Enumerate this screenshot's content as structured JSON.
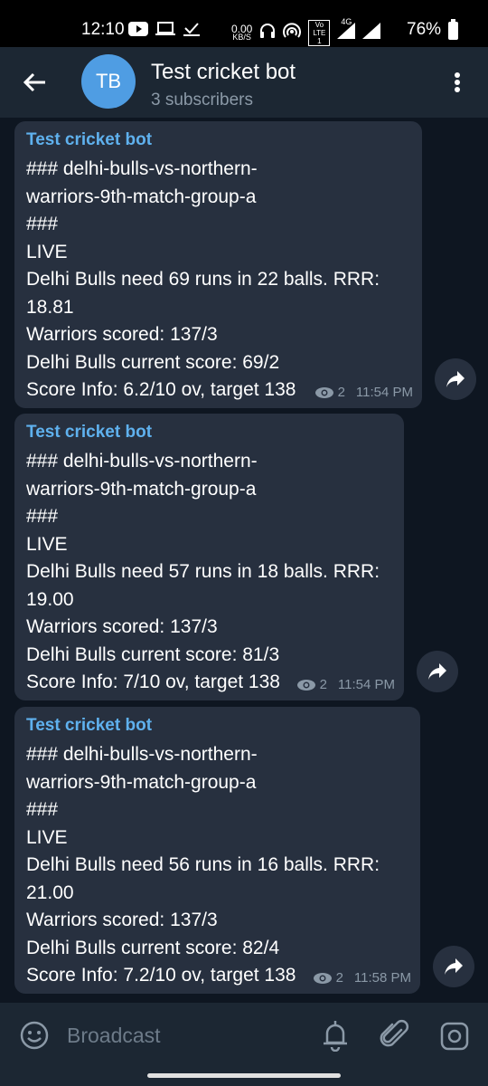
{
  "status_bar": {
    "time": "12:10",
    "netspeed_value": "0.00",
    "netspeed_unit": "KB/S",
    "volte_label": "Vo LTE 1",
    "network_label": "4G",
    "battery_percent": "76%"
  },
  "header": {
    "avatar_initials": "TB",
    "title": "Test cricket bot",
    "subtitle": "3 subscribers"
  },
  "messages": [
    {
      "sender": "Test cricket bot",
      "lines": [
        "### delhi-bulls-vs-northern-",
        "warriors-9th-match-group-a",
        "###",
        "LIVE",
        "Delhi Bulls need 69 runs in 22 balls. RRR:",
        "18.81",
        "Warriors scored: 137/3",
        "Delhi Bulls current score: 69/2",
        "Score Info: 6.2/10 ov, target 138"
      ],
      "views": "2",
      "time": "11:54 PM"
    },
    {
      "sender": "Test cricket bot",
      "lines": [
        "### delhi-bulls-vs-northern-",
        "warriors-9th-match-group-a",
        "###",
        "LIVE",
        "Delhi Bulls need 57 runs in 18 balls. RRR:",
        "19.00",
        "Warriors scored: 137/3",
        "Delhi Bulls current score: 81/3",
        "Score Info: 7/10 ov, target 138"
      ],
      "views": "2",
      "time": "11:54 PM"
    },
    {
      "sender": "Test cricket bot",
      "lines": [
        "### delhi-bulls-vs-northern-",
        "warriors-9th-match-group-a",
        "###",
        "LIVE",
        "Delhi Bulls need 56 runs in 16 balls. RRR:",
        "21.00",
        "Warriors scored: 137/3",
        "Delhi Bulls current score: 82/4",
        "Score Info: 7.2/10 ov, target 138"
      ],
      "views": "2",
      "time": "11:58 PM"
    }
  ],
  "composer": {
    "placeholder": "Broadcast"
  },
  "icons": {
    "back": "arrow-left-icon",
    "menu": "more-vertical-icon",
    "share": "forward-icon",
    "views": "eye-icon",
    "emoji": "emoji-icon",
    "bell": "bell-icon",
    "attach": "paperclip-icon",
    "camera": "camera-icon"
  },
  "colors": {
    "background": "#0e1621",
    "header": "#1c2733",
    "bubble": "#27303f",
    "sender": "#5fb1ee",
    "avatar": "#4f9de3",
    "muted": "#8b99a7"
  }
}
